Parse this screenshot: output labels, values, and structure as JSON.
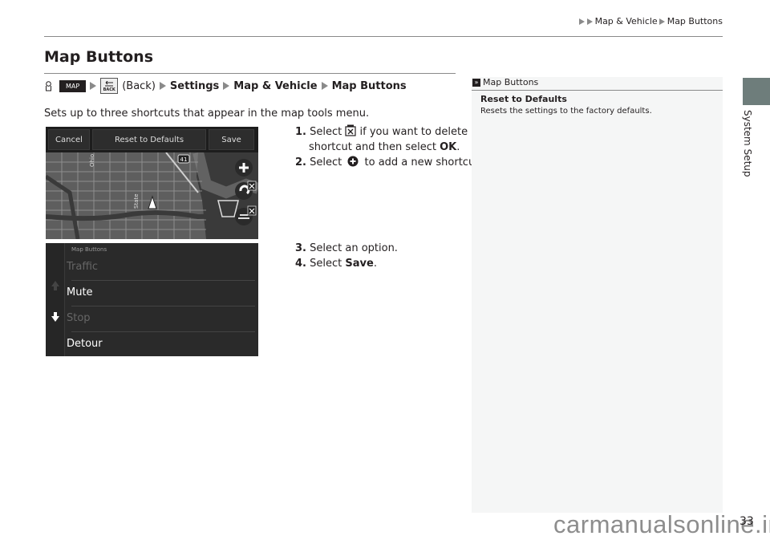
{
  "header": {
    "breadcrumb": [
      "Map & Vehicle",
      "Map Buttons"
    ]
  },
  "side_tab": {
    "label": "System Setup",
    "color": "#6e7d7b"
  },
  "page": {
    "title": "Map Buttons",
    "number": "33"
  },
  "path": {
    "home_icon": "home-icon",
    "map_button": "MAP",
    "back_label": "BACK",
    "back_text": "(Back)",
    "items": [
      "Settings",
      "Map & Vehicle",
      "Map Buttons"
    ]
  },
  "intro": "Sets up to three shortcuts that appear in the map tools menu.",
  "screen1": {
    "buttons": [
      "Cancel",
      "Reset to Defaults",
      "Save"
    ],
    "route_badge": "41",
    "street_labels": [
      "Ohio",
      "State"
    ]
  },
  "screen2": {
    "heading": "Map Buttons",
    "items": [
      {
        "label": "Traffic",
        "enabled": false
      },
      {
        "label": "Mute",
        "enabled": true
      },
      {
        "label": "Stop",
        "enabled": false
      },
      {
        "label": "Detour",
        "enabled": true
      }
    ]
  },
  "steps": [
    {
      "num": "1.",
      "pre": "Select",
      "icon": "trash-x-icon",
      "post": "if you want to delete a",
      "line2_pre": "shortcut and then select ",
      "line2_bold": "OK",
      "line2_post": "."
    },
    {
      "num": "2.",
      "pre": "Select",
      "icon": "plus-circle-icon",
      "post": "to add a new shortcut."
    },
    {
      "num": "3.",
      "text": "Select an option."
    },
    {
      "num": "4.",
      "pre": "Select ",
      "bold": "Save",
      "post": "."
    }
  ],
  "note": {
    "title": "Map Buttons",
    "heading": "Reset to Defaults",
    "text": "Resets the settings to the factory defaults."
  },
  "watermark": "carmanualsonline.info"
}
